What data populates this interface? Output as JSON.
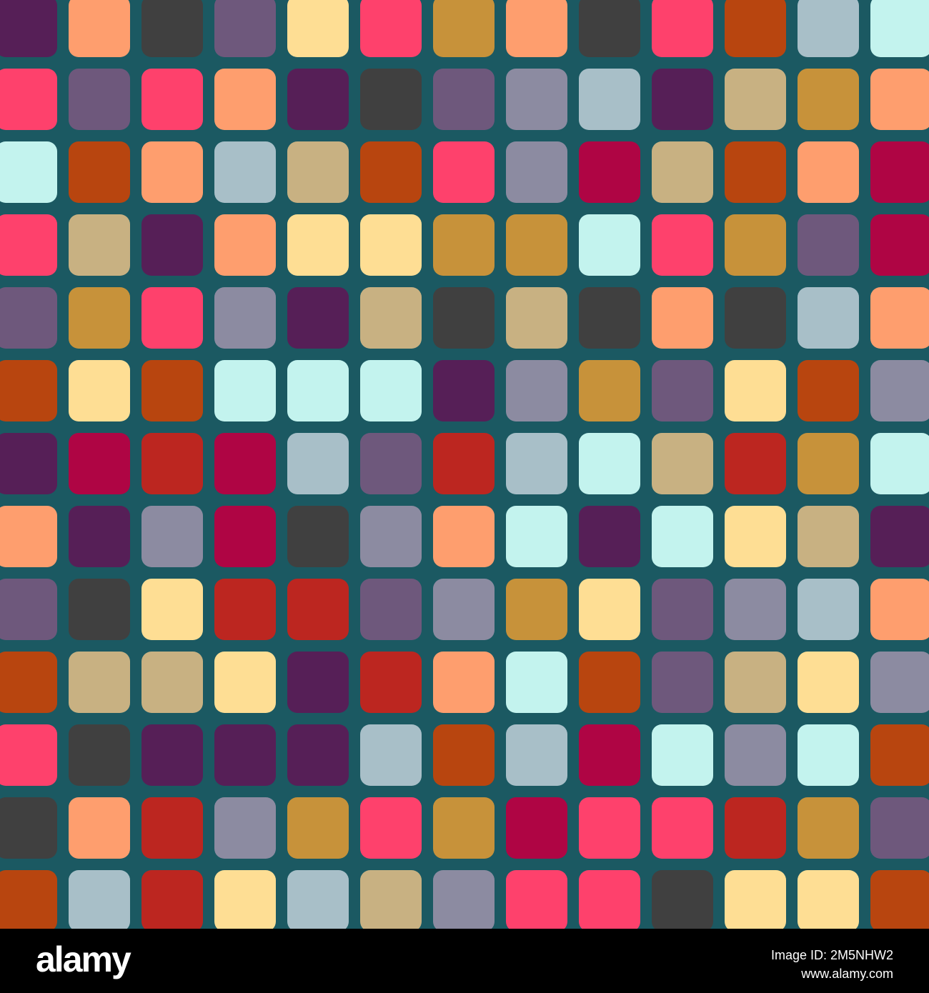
{
  "palette": {
    "A": "#561f57",
    "B": "#fe9e6e",
    "C": "#404040",
    "D": "#6e587c",
    "E": "#fede94",
    "F": "#fe416c",
    "G": "#c7923a",
    "H": "#b8450f",
    "I": "#a8bfc8",
    "J": "#c3f3ee",
    "K": "#8c8ba1",
    "L": "#c8b182",
    "M": "#af0544",
    "N": "#bc2620"
  },
  "background_color": "#1b5962",
  "tile_rows": [
    "ABCDEFGBCFHIJ",
    "FDFBACDKIALGB",
    "JHBILHFKMLHBM",
    "FLABEEGGJFGDM",
    "DGFKALCLCBCIB",
    "HEHJJJAKGDEHK",
    "AMNMIDNIJLNGJ",
    "BAKMCKBJAJELA",
    "DCENNDKGEDKIB",
    "HLLEANBJHDLEK",
    "FCAAAIHIMJKJH",
    "CBNKGFGMFFNGD",
    "HINEILKFFCEEH"
  ],
  "footer": {
    "logo": "alamy",
    "image_id": "Image ID: 2M5NHW2",
    "url": "www.alamy.com"
  }
}
